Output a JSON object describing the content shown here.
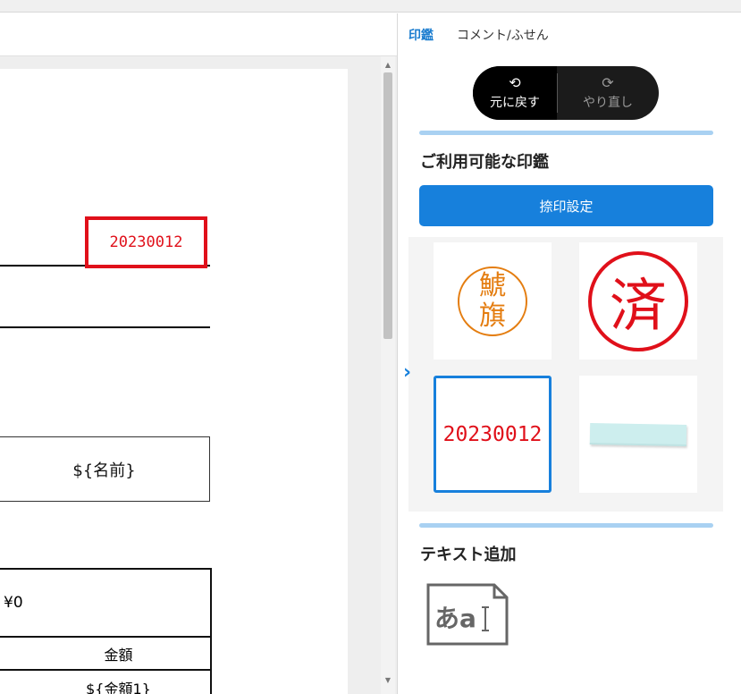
{
  "document": {
    "stamp_date": "20230012",
    "name_placeholder": "${名前}",
    "table": {
      "top_cell": "¥0",
      "header": "金額",
      "value": "${金額1}"
    }
  },
  "panel": {
    "tabs": [
      {
        "label": "印鑑",
        "active": true
      },
      {
        "label": "コメント/ふせん",
        "active": false
      }
    ],
    "undo_label": "元に戻す",
    "redo_label": "やり直し",
    "available_seals_title": "ご利用可能な印鑑",
    "stamp_settings_label": "捺印設定",
    "seals": [
      {
        "kind": "name-seal",
        "lines": [
          "鯱",
          "旗"
        ],
        "color": "#e47d10"
      },
      {
        "kind": "text-seal",
        "text": "済",
        "color": "#e0101a"
      },
      {
        "kind": "date-seal",
        "text": "20230012",
        "color": "#e0101a",
        "selected": true
      },
      {
        "kind": "sticky-note",
        "color": "#cdeeee"
      }
    ],
    "text_add_title": "テキスト追加",
    "text_add_icon_text": "あa"
  },
  "colors": {
    "accent": "#1780dc",
    "divider": "#a9d1f2",
    "stamp_red": "#e0101a",
    "seal_orange": "#e47d10"
  }
}
